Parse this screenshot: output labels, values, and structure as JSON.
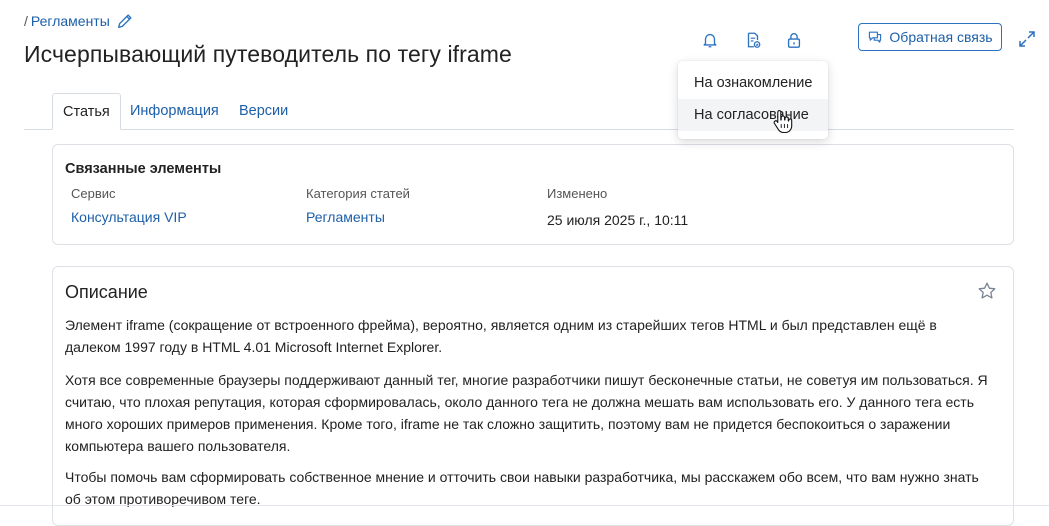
{
  "breadcrumb": {
    "separator": "/",
    "label": "Регламенты"
  },
  "page": {
    "title": "Исчерпывающий путеводитель по тегу iframe"
  },
  "toolbar": {
    "feedback_label": "Обратная связь"
  },
  "dropdown": {
    "items": [
      "На ознакомление",
      "На согласование"
    ]
  },
  "tabs": [
    "Статья",
    "Информация",
    "Версии"
  ],
  "related": {
    "title": "Связанные элементы",
    "columns": [
      {
        "label": "Сервис",
        "value": "Консультация VIP"
      },
      {
        "label": "Категория статей",
        "value": "Регламенты"
      },
      {
        "label": "Изменено",
        "value": "25 июля 2025 г., 10:11"
      }
    ]
  },
  "description": {
    "title": "Описание",
    "paragraphs": [
      "Элемент iframe (сокращение от встроенного фрейма), вероятно, является одним из старейших тегов HTML и был представлен ещё в далеком 1997 году в HTML 4.01 Microsoft Internet Explorer.",
      "Хотя все современные браузеры поддерживают данный тег, многие разработчики пишут бесконечные статьи, не советуя им пользоваться. Я считаю, что плохая репутация, которая сформировалась, около данного тега не должна мешать вам использовать его. У данного тега есть много хороших примеров применения. Кроме того, iframe не так сложно защитить, поэтому вам не придется беспокоиться о заражении компьютера вашего пользователя.",
      "Чтобы помочь вам сформировать собственное мнение и отточить свои навыки разработчика, мы расскажем обо всем, что вам нужно знать об этом противоречивом теге."
    ]
  },
  "colors": {
    "accent": "#1d5fa8",
    "border": "#dde1e6"
  }
}
